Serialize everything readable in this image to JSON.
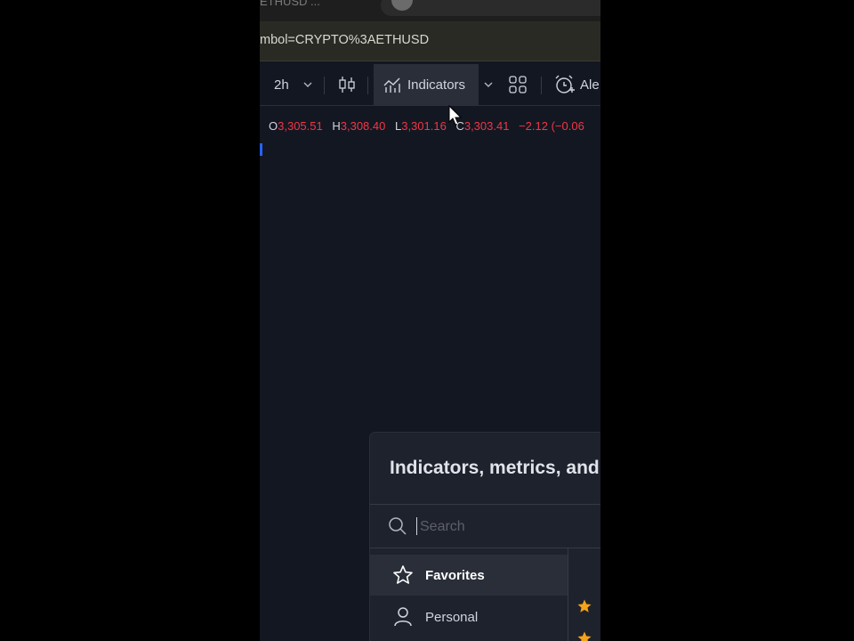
{
  "browser": {
    "tab_title": "ETHUSD ...",
    "url_fragment": "mbol=CRYPTO%3AETHUSD"
  },
  "toolbar": {
    "interval": "2h",
    "indicators_label": "Indicators",
    "alert_label_partial": "Ale"
  },
  "ohlc": {
    "open_label": "O",
    "open": "3,305.51",
    "high_label": "H",
    "high": "3,308.40",
    "low_label": "L",
    "low": "3,301.16",
    "close_label": "C",
    "close": "3,303.41",
    "change": "−2.12 (−0.06"
  },
  "dialog": {
    "title_partial": "Indicators, metrics, and",
    "search_placeholder": "Search",
    "sidebar": [
      {
        "label": "Favorites",
        "icon": "star-outline-icon",
        "active": true
      },
      {
        "label": "Personal",
        "icon": "user-icon",
        "active": false
      }
    ]
  },
  "colors": {
    "background": "#131722",
    "down": "#f23645",
    "favorite_star": "#f7a21b",
    "text": "#d1d4dc"
  }
}
